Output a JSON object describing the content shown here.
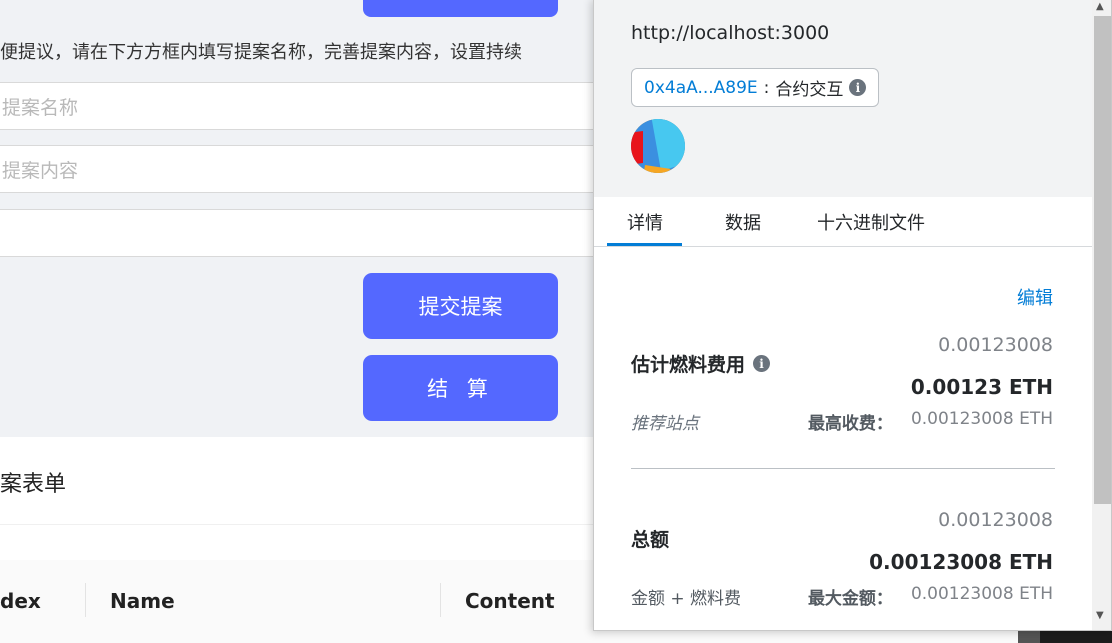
{
  "background_page": {
    "intro_text": "便提议，请在下方方框内填写提案名称，完善提案内容，设置持续",
    "proposal_name_placeholder": "提案名称",
    "proposal_content_placeholder": "提案内容",
    "submit_button": "提交提案",
    "settle_button": "结 算",
    "list_title": "案表单",
    "table_columns": [
      "dex",
      "Name",
      "Content"
    ]
  },
  "metamask": {
    "origin": "http://localhost:3000",
    "account_chip": {
      "address": "0x4aA...A89E",
      "separator": ":",
      "kind": "合约交互",
      "info_icon": "info-icon"
    },
    "tabs": [
      {
        "label": "详情",
        "active": true
      },
      {
        "label": "数据",
        "active": false
      },
      {
        "label": "十六进制文件",
        "active": false
      }
    ],
    "edit_link": "编辑",
    "gas": {
      "label": "估计燃料费用",
      "value_secondary": "0.00123008",
      "value_primary": "0.00123 ETH",
      "note": "推荐站点",
      "max_label": "最高收费：",
      "max_value": "0.00123008 ETH"
    },
    "total": {
      "label": "总额",
      "value_secondary": "0.00123008",
      "value_primary": "0.00123008 ETH",
      "note": "金额 + 燃料费",
      "max_label": "最大金额：",
      "max_value": "0.00123008 ETH"
    },
    "colors": {
      "link_blue": "#037dd6",
      "primary_button": "#5468ff"
    }
  }
}
